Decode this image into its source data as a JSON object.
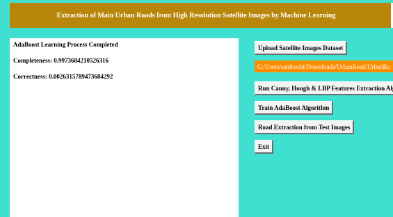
{
  "header": {
    "title": "Extraction of Main Urban Roads from High Resolution Satellite Images by Machine Learning"
  },
  "output": {
    "lines": [
      "AdaBoost Learning Process Completed",
      "Completeness: 0.9973684210526316",
      "Correctness: 0.0026315789473684292"
    ]
  },
  "controls": {
    "upload_label": "Upload Satellite Images Dataset",
    "path_value": "C:/Users/santhoshi/Downloads/UrbanRoad/UrbanRo",
    "features_label": "Run Canny, Hough & LBP Features Extraction Algo",
    "train_label": "Train AdaBoost Algorithm",
    "extract_label": "Road Extraction from Test Images",
    "exit_label": "Exit"
  },
  "colors": {
    "background": "#40e0d0",
    "title_bar": "#b8860b",
    "path_label": "#ff8c00",
    "button": "#f3f3f3"
  }
}
